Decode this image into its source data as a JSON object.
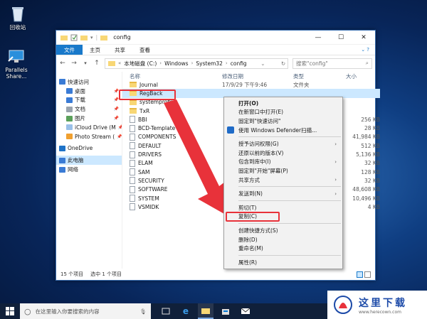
{
  "desktop": {
    "icons": [
      {
        "label": "回收站",
        "icon": "recycle-bin-icon"
      },
      {
        "label": "Parallels Share...",
        "icon": "parallels-share-icon"
      }
    ]
  },
  "window": {
    "title": "config",
    "controls": {
      "minimize": "—",
      "maximize": "☐",
      "close": "✕"
    },
    "ribbon_tabs": [
      "文件",
      "主页",
      "共享",
      "查看"
    ],
    "address": {
      "segments": [
        "本地磁盘 (C:)",
        "Windows",
        "System32",
        "config"
      ]
    },
    "search_placeholder": "搜索\"config\"",
    "nav_pane": [
      {
        "label": "快速访问",
        "icon": "star-icon",
        "pinned": false
      },
      {
        "label": "桌面",
        "icon": "desktop-icon",
        "pinned": true
      },
      {
        "label": "下载",
        "icon": "download-icon",
        "pinned": true
      },
      {
        "label": "文档",
        "icon": "document-icon",
        "pinned": true
      },
      {
        "label": "图片",
        "icon": "picture-icon",
        "pinned": true
      },
      {
        "label": "iCloud Drive (M",
        "icon": "cloud-icon",
        "pinned": true
      },
      {
        "label": "Photo Stream (",
        "icon": "photo-stream-icon",
        "pinned": true
      },
      {
        "label": "OneDrive",
        "icon": "onedrive-icon",
        "pinned": false
      },
      {
        "label": "此电脑",
        "icon": "computer-icon",
        "pinned": false
      },
      {
        "label": "网络",
        "icon": "network-icon",
        "pinned": false
      }
    ],
    "columns": {
      "name": "名称",
      "date": "修改日期",
      "type": "类型",
      "size": "大小"
    },
    "files": [
      {
        "name": "Journal",
        "date": "17/9/29 下午9:46",
        "type": "文件夹",
        "size": "",
        "kind": "folder"
      },
      {
        "name": "RegBack",
        "date": "",
        "type": "",
        "size": "",
        "kind": "folder"
      },
      {
        "name": "systemprofile",
        "date": "",
        "type": "",
        "size": "",
        "kind": "folder"
      },
      {
        "name": "TxR",
        "date": "",
        "type": "",
        "size": "",
        "kind": "folder"
      },
      {
        "name": "BBI",
        "date": "",
        "type": "",
        "size": "256 KB",
        "kind": "file"
      },
      {
        "name": "BCD-Template",
        "date": "",
        "type": "",
        "size": "28 KB",
        "kind": "file"
      },
      {
        "name": "COMPONENTS",
        "date": "",
        "type": "",
        "size": "41,984 KB",
        "kind": "file"
      },
      {
        "name": "DEFAULT",
        "date": "",
        "type": "",
        "size": "512 KB",
        "kind": "file"
      },
      {
        "name": "DRIVERS",
        "date": "",
        "type": "",
        "size": "5,136 KB",
        "kind": "file"
      },
      {
        "name": "ELAM",
        "date": "",
        "type": "",
        "size": "32 KB",
        "kind": "file"
      },
      {
        "name": "SAM",
        "date": "",
        "type": "",
        "size": "128 KB",
        "kind": "file"
      },
      {
        "name": "SECURITY",
        "date": "",
        "type": "",
        "size": "32 KB",
        "kind": "file"
      },
      {
        "name": "SOFTWARE",
        "date": "",
        "type": "",
        "size": "48,608 KB",
        "kind": "file"
      },
      {
        "name": "SYSTEM",
        "date": "",
        "type": "",
        "size": "10,496 KB",
        "kind": "file"
      },
      {
        "name": "VSMIDK",
        "date": "",
        "type": "",
        "size": "4 KB",
        "kind": "file"
      }
    ],
    "status": {
      "count": "15 个项目",
      "selected": "选中 1 个项目"
    }
  },
  "context_menu": [
    {
      "label": "打开(O)",
      "bold": true
    },
    {
      "label": "在新窗口中打开(E)"
    },
    {
      "label": "固定到\"快速访问\""
    },
    {
      "label": "使用 Windows Defender扫描...",
      "icon": "windows-defender-icon"
    },
    {
      "sep": true
    },
    {
      "label": "授予访问权限(G)",
      "submenu": true
    },
    {
      "label": "还原以前的版本(V)"
    },
    {
      "label": "包含到库中(I)",
      "submenu": true
    },
    {
      "label": "固定到\"开始\"屏幕(P)"
    },
    {
      "label": "共享方式",
      "submenu": true
    },
    {
      "sep": true
    },
    {
      "label": "发送到(N)",
      "submenu": true
    },
    {
      "sep": true
    },
    {
      "label": "剪切(T)"
    },
    {
      "label": "复制(C)",
      "highlighted": true
    },
    {
      "sep": true
    },
    {
      "label": "创建快捷方式(S)"
    },
    {
      "label": "删除(D)"
    },
    {
      "label": "重命名(M)"
    },
    {
      "sep": true
    },
    {
      "label": "属性(R)"
    }
  ],
  "taskbar": {
    "search_placeholder": "在这里输入你要搜索的内容",
    "apps": [
      "task-view-icon",
      "edge-icon",
      "file-explorer-icon",
      "store-icon",
      "mail-icon"
    ]
  },
  "watermark": {
    "text": "这里下载",
    "url": "www.herecown.com"
  },
  "colors": {
    "accent": "#1979ca",
    "highlight_red": "#e8323a",
    "arrow_red": "#e8323a",
    "selection": "#cce8ff"
  }
}
